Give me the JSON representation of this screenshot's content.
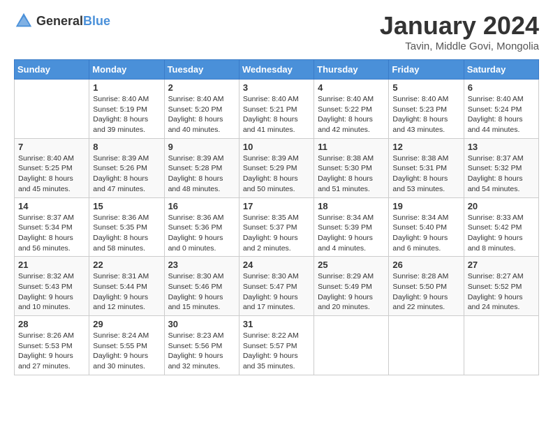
{
  "logo": {
    "text_general": "General",
    "text_blue": "Blue"
  },
  "title": "January 2024",
  "location": "Tavin, Middle Govi, Mongolia",
  "days_of_week": [
    "Sunday",
    "Monday",
    "Tuesday",
    "Wednesday",
    "Thursday",
    "Friday",
    "Saturday"
  ],
  "weeks": [
    [
      {
        "day": "",
        "sunrise": "",
        "sunset": "",
        "daylight": ""
      },
      {
        "day": "1",
        "sunrise": "Sunrise: 8:40 AM",
        "sunset": "Sunset: 5:19 PM",
        "daylight": "Daylight: 8 hours and 39 minutes."
      },
      {
        "day": "2",
        "sunrise": "Sunrise: 8:40 AM",
        "sunset": "Sunset: 5:20 PM",
        "daylight": "Daylight: 8 hours and 40 minutes."
      },
      {
        "day": "3",
        "sunrise": "Sunrise: 8:40 AM",
        "sunset": "Sunset: 5:21 PM",
        "daylight": "Daylight: 8 hours and 41 minutes."
      },
      {
        "day": "4",
        "sunrise": "Sunrise: 8:40 AM",
        "sunset": "Sunset: 5:22 PM",
        "daylight": "Daylight: 8 hours and 42 minutes."
      },
      {
        "day": "5",
        "sunrise": "Sunrise: 8:40 AM",
        "sunset": "Sunset: 5:23 PM",
        "daylight": "Daylight: 8 hours and 43 minutes."
      },
      {
        "day": "6",
        "sunrise": "Sunrise: 8:40 AM",
        "sunset": "Sunset: 5:24 PM",
        "daylight": "Daylight: 8 hours and 44 minutes."
      }
    ],
    [
      {
        "day": "7",
        "sunrise": "Sunrise: 8:40 AM",
        "sunset": "Sunset: 5:25 PM",
        "daylight": "Daylight: 8 hours and 45 minutes."
      },
      {
        "day": "8",
        "sunrise": "Sunrise: 8:39 AM",
        "sunset": "Sunset: 5:26 PM",
        "daylight": "Daylight: 8 hours and 47 minutes."
      },
      {
        "day": "9",
        "sunrise": "Sunrise: 8:39 AM",
        "sunset": "Sunset: 5:28 PM",
        "daylight": "Daylight: 8 hours and 48 minutes."
      },
      {
        "day": "10",
        "sunrise": "Sunrise: 8:39 AM",
        "sunset": "Sunset: 5:29 PM",
        "daylight": "Daylight: 8 hours and 50 minutes."
      },
      {
        "day": "11",
        "sunrise": "Sunrise: 8:38 AM",
        "sunset": "Sunset: 5:30 PM",
        "daylight": "Daylight: 8 hours and 51 minutes."
      },
      {
        "day": "12",
        "sunrise": "Sunrise: 8:38 AM",
        "sunset": "Sunset: 5:31 PM",
        "daylight": "Daylight: 8 hours and 53 minutes."
      },
      {
        "day": "13",
        "sunrise": "Sunrise: 8:37 AM",
        "sunset": "Sunset: 5:32 PM",
        "daylight": "Daylight: 8 hours and 54 minutes."
      }
    ],
    [
      {
        "day": "14",
        "sunrise": "Sunrise: 8:37 AM",
        "sunset": "Sunset: 5:34 PM",
        "daylight": "Daylight: 8 hours and 56 minutes."
      },
      {
        "day": "15",
        "sunrise": "Sunrise: 8:36 AM",
        "sunset": "Sunset: 5:35 PM",
        "daylight": "Daylight: 8 hours and 58 minutes."
      },
      {
        "day": "16",
        "sunrise": "Sunrise: 8:36 AM",
        "sunset": "Sunset: 5:36 PM",
        "daylight": "Daylight: 9 hours and 0 minutes."
      },
      {
        "day": "17",
        "sunrise": "Sunrise: 8:35 AM",
        "sunset": "Sunset: 5:37 PM",
        "daylight": "Daylight: 9 hours and 2 minutes."
      },
      {
        "day": "18",
        "sunrise": "Sunrise: 8:34 AM",
        "sunset": "Sunset: 5:39 PM",
        "daylight": "Daylight: 9 hours and 4 minutes."
      },
      {
        "day": "19",
        "sunrise": "Sunrise: 8:34 AM",
        "sunset": "Sunset: 5:40 PM",
        "daylight": "Daylight: 9 hours and 6 minutes."
      },
      {
        "day": "20",
        "sunrise": "Sunrise: 8:33 AM",
        "sunset": "Sunset: 5:42 PM",
        "daylight": "Daylight: 9 hours and 8 minutes."
      }
    ],
    [
      {
        "day": "21",
        "sunrise": "Sunrise: 8:32 AM",
        "sunset": "Sunset: 5:43 PM",
        "daylight": "Daylight: 9 hours and 10 minutes."
      },
      {
        "day": "22",
        "sunrise": "Sunrise: 8:31 AM",
        "sunset": "Sunset: 5:44 PM",
        "daylight": "Daylight: 9 hours and 12 minutes."
      },
      {
        "day": "23",
        "sunrise": "Sunrise: 8:30 AM",
        "sunset": "Sunset: 5:46 PM",
        "daylight": "Daylight: 9 hours and 15 minutes."
      },
      {
        "day": "24",
        "sunrise": "Sunrise: 8:30 AM",
        "sunset": "Sunset: 5:47 PM",
        "daylight": "Daylight: 9 hours and 17 minutes."
      },
      {
        "day": "25",
        "sunrise": "Sunrise: 8:29 AM",
        "sunset": "Sunset: 5:49 PM",
        "daylight": "Daylight: 9 hours and 20 minutes."
      },
      {
        "day": "26",
        "sunrise": "Sunrise: 8:28 AM",
        "sunset": "Sunset: 5:50 PM",
        "daylight": "Daylight: 9 hours and 22 minutes."
      },
      {
        "day": "27",
        "sunrise": "Sunrise: 8:27 AM",
        "sunset": "Sunset: 5:52 PM",
        "daylight": "Daylight: 9 hours and 24 minutes."
      }
    ],
    [
      {
        "day": "28",
        "sunrise": "Sunrise: 8:26 AM",
        "sunset": "Sunset: 5:53 PM",
        "daylight": "Daylight: 9 hours and 27 minutes."
      },
      {
        "day": "29",
        "sunrise": "Sunrise: 8:24 AM",
        "sunset": "Sunset: 5:55 PM",
        "daylight": "Daylight: 9 hours and 30 minutes."
      },
      {
        "day": "30",
        "sunrise": "Sunrise: 8:23 AM",
        "sunset": "Sunset: 5:56 PM",
        "daylight": "Daylight: 9 hours and 32 minutes."
      },
      {
        "day": "31",
        "sunrise": "Sunrise: 8:22 AM",
        "sunset": "Sunset: 5:57 PM",
        "daylight": "Daylight: 9 hours and 35 minutes."
      },
      {
        "day": "",
        "sunrise": "",
        "sunset": "",
        "daylight": ""
      },
      {
        "day": "",
        "sunrise": "",
        "sunset": "",
        "daylight": ""
      },
      {
        "day": "",
        "sunrise": "",
        "sunset": "",
        "daylight": ""
      }
    ]
  ]
}
